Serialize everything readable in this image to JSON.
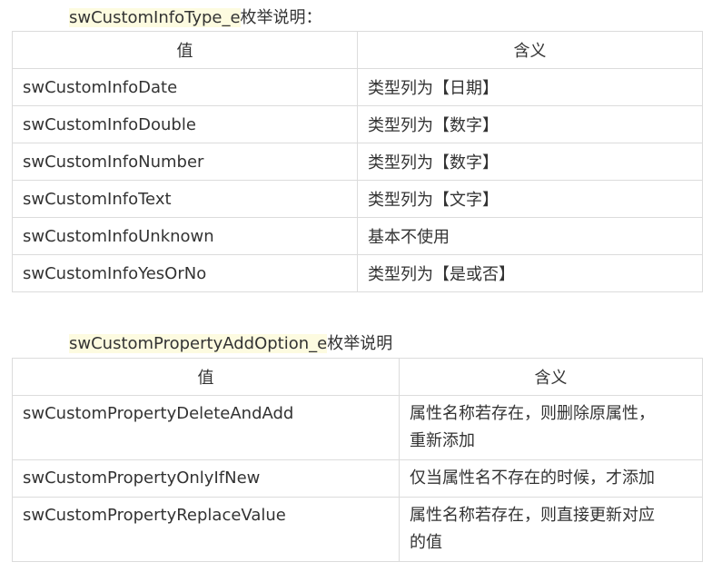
{
  "section1": {
    "heading_code": "swCustomInfoType_e",
    "heading_suffix": "枚举说明：",
    "header": {
      "value": "值",
      "meaning": "含义"
    },
    "rows": [
      {
        "value": "swCustomInfoDate",
        "meaning": "类型列为【日期】"
      },
      {
        "value": "swCustomInfoDouble",
        "meaning": "类型列为【数字】"
      },
      {
        "value": "swCustomInfoNumber",
        "meaning": "类型列为【数字】"
      },
      {
        "value": "swCustomInfoText",
        "meaning": "类型列为【文字】"
      },
      {
        "value": "swCustomInfoUnknown",
        "meaning": "基本不使用"
      },
      {
        "value": "swCustomInfoYesOrNo",
        "meaning": "类型列为【是或否】"
      }
    ]
  },
  "section2": {
    "heading_code": "swCustomPropertyAddOption_e",
    "heading_suffix": "枚举说明",
    "header": {
      "value": "值",
      "meaning": "含义"
    },
    "rows": [
      {
        "value": "swCustomPropertyDeleteAndAdd",
        "meaning_line1": "属性名称若存在，则删除原属性，",
        "meaning_line2": "重新添加"
      },
      {
        "value": "swCustomPropertyOnlyIfNew",
        "meaning_line1": "仅当属性名不存在的时候，才添加"
      },
      {
        "value": "swCustomPropertyReplaceValue",
        "meaning_line1": "属性名称若存在，则直接更新对应",
        "meaning_line2": "的值"
      }
    ]
  }
}
